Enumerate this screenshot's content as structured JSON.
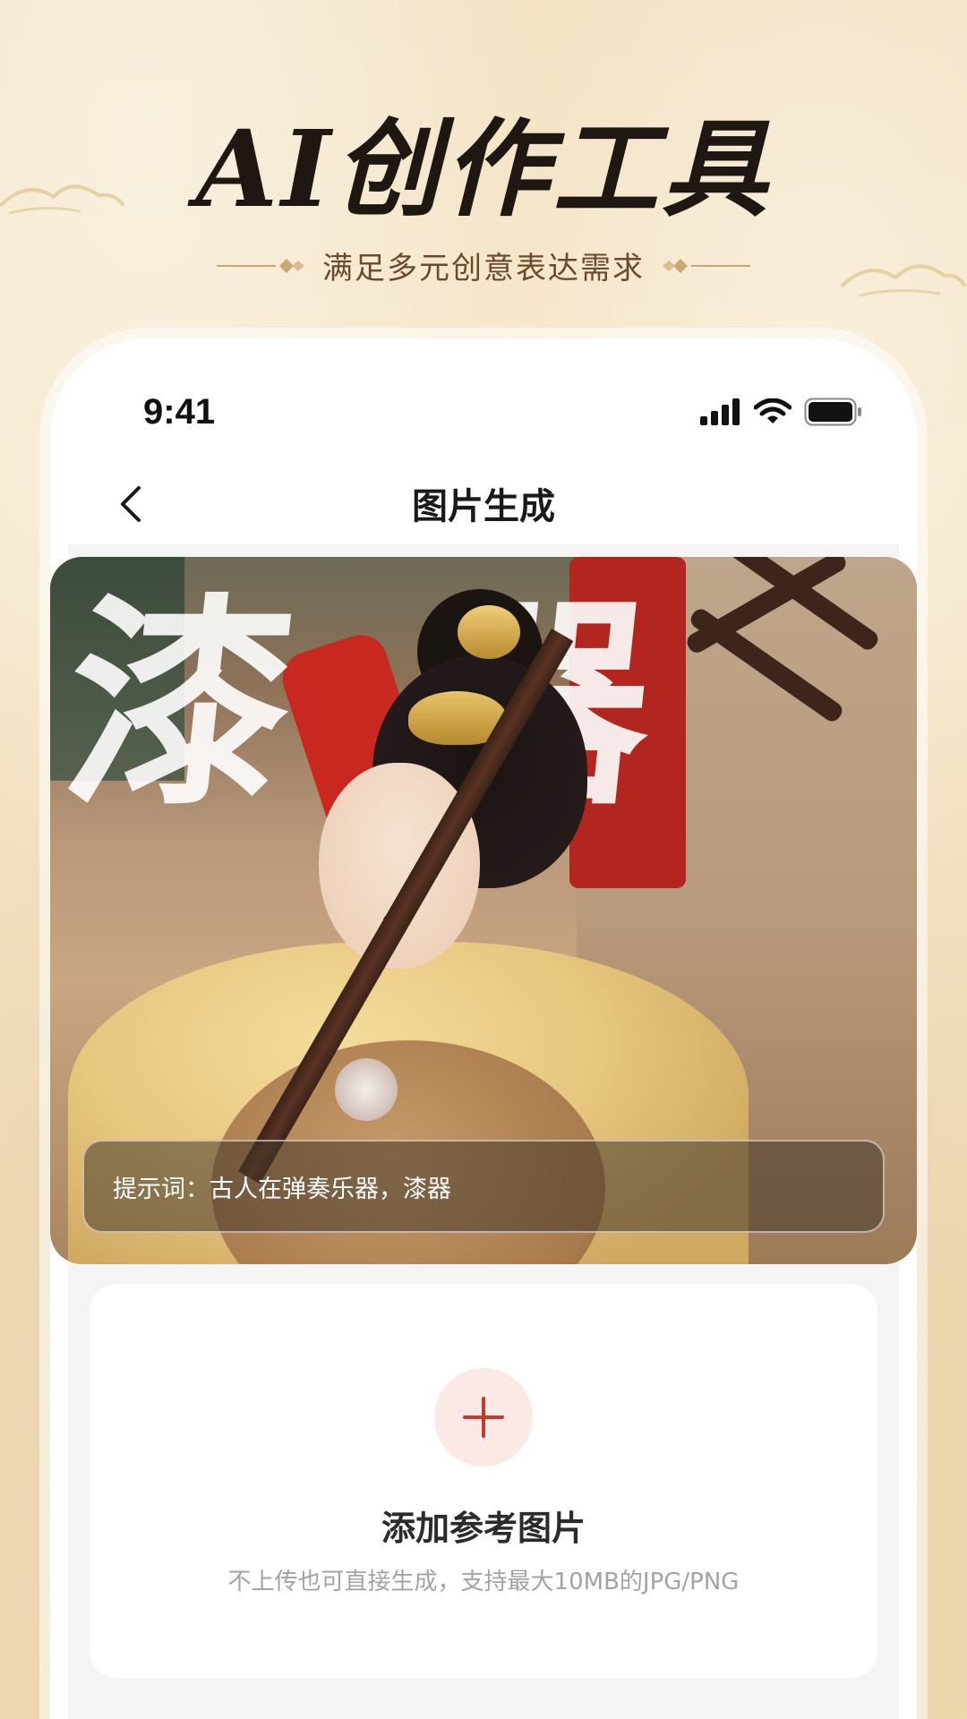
{
  "hero": {
    "title": "AI创作工具",
    "subtitle": "满足多元创意表达需求"
  },
  "status_bar": {
    "time": "9:41",
    "icons": [
      "signal-icon",
      "wifi-icon",
      "battery-icon"
    ]
  },
  "navbar": {
    "back_icon": "chevron-left-icon",
    "title": "图片生成"
  },
  "sample": {
    "watermark": "漆器",
    "prompt": "提示词：古人在弹奏乐器，漆器"
  },
  "upload": {
    "icon": "plus-icon",
    "title": "添加参考图片",
    "description": "不上传也可直接生成，支持最大10MB的JPG/PNG"
  },
  "colors": {
    "background": "#f3e3c4",
    "accent_red": "#c8392b",
    "plus_bg": "#fbe9e5",
    "title_dark": "#1f1812",
    "subtitle_brown": "#6b4a2c"
  }
}
